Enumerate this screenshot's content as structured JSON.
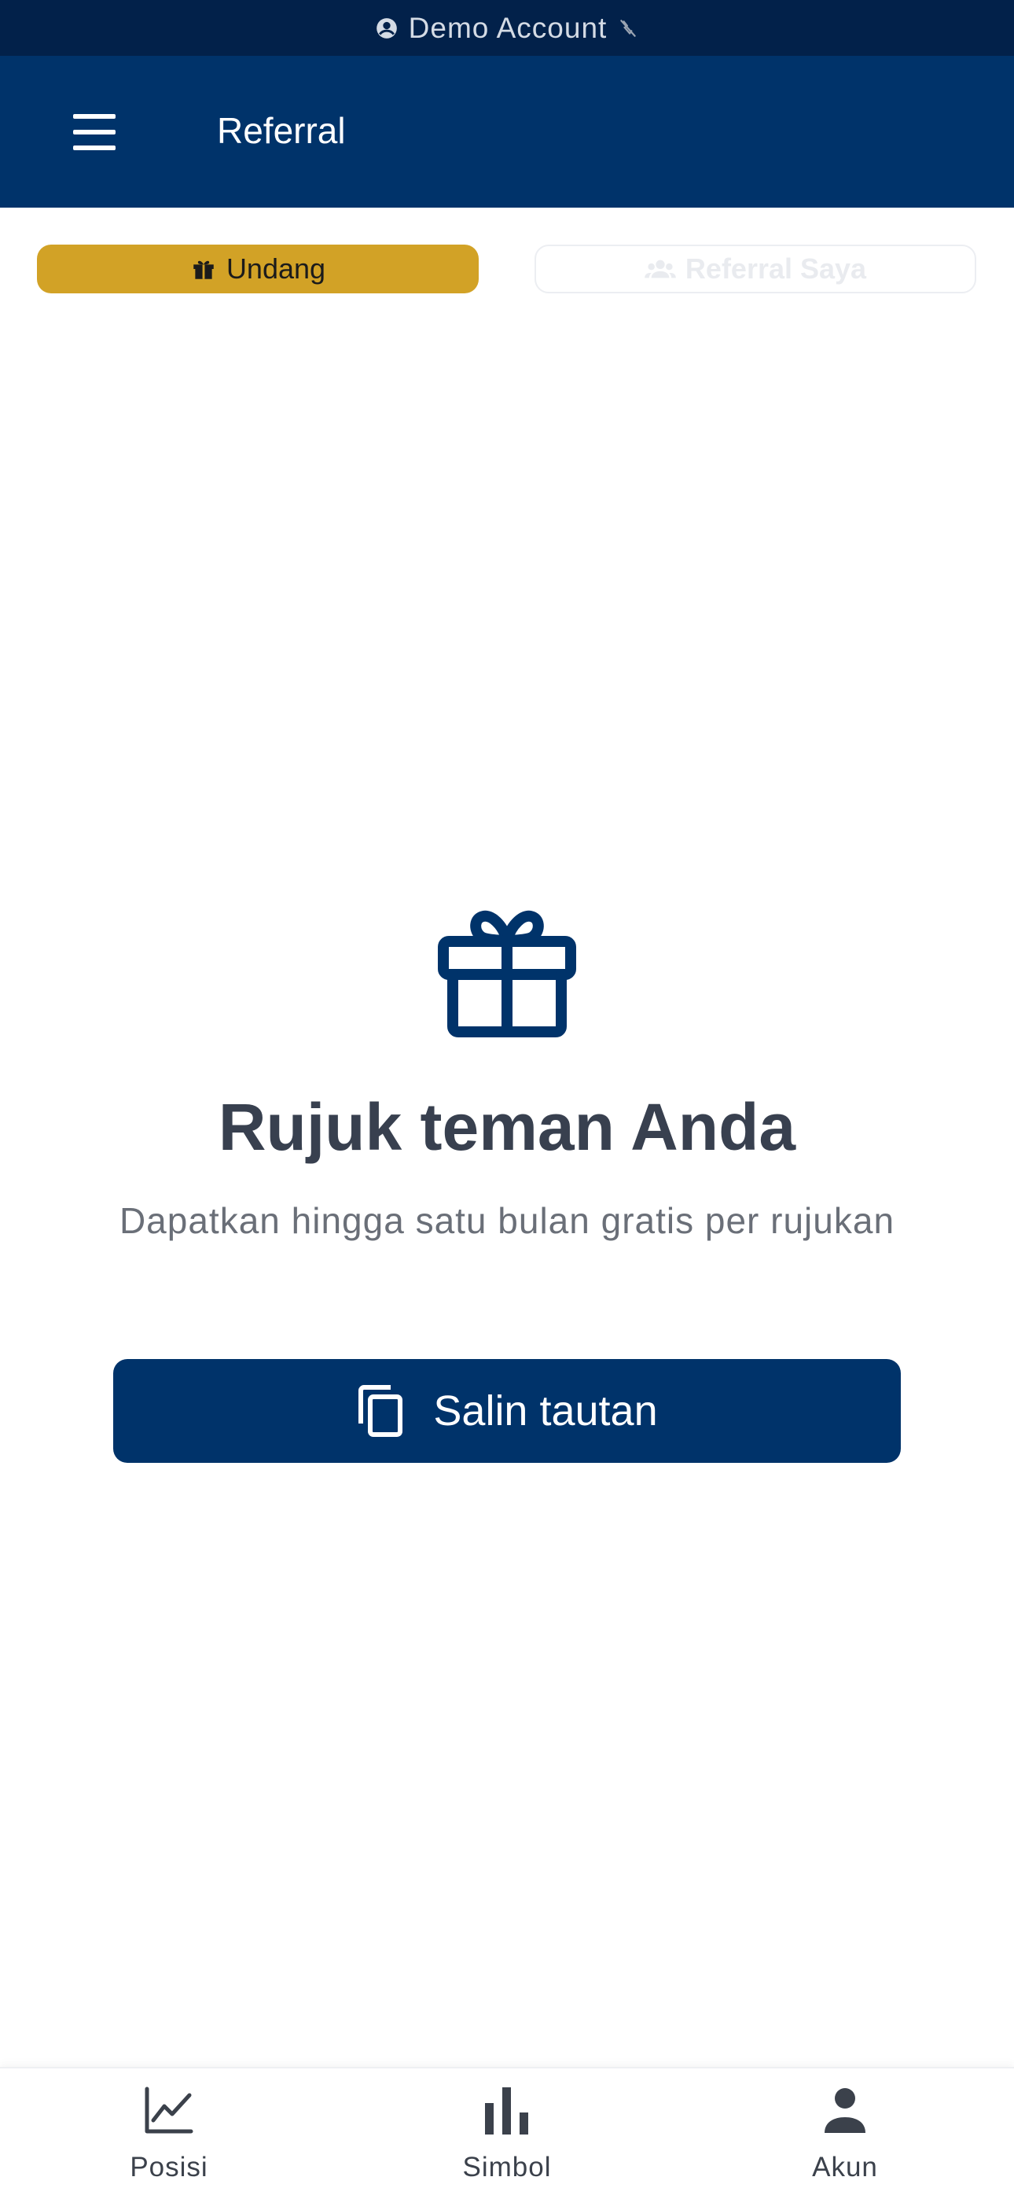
{
  "status_bar": {
    "account_label": "Demo Account",
    "account_icon": "account-circle-icon",
    "signal_icon": "signal-off-icon"
  },
  "app_bar": {
    "menu_icon": "hamburger-menu-icon",
    "title": "Referral"
  },
  "tabs": [
    {
      "label": "Undang",
      "icon": "gift-icon",
      "active": true
    },
    {
      "label": "Referral Saya",
      "icon": "people-icon",
      "active": false
    }
  ],
  "hero": {
    "icon": "gift-icon",
    "title": "Rujuk teman Anda",
    "subtitle": "Dapatkan hingga satu bulan gratis per rujukan",
    "button_label": "Salin tautan",
    "button_icon": "copy-icon"
  },
  "bottom_nav": [
    {
      "label": "Posisi",
      "icon": "line-chart-icon"
    },
    {
      "label": "Simbol",
      "icon": "bar-chart-icon"
    },
    {
      "label": "Akun",
      "icon": "person-icon"
    }
  ],
  "colors": {
    "primary": "#00336a",
    "status_bar": "#02214a",
    "accent": "#d2a226",
    "heading": "#38404f",
    "body_text": "#6a6f78"
  }
}
